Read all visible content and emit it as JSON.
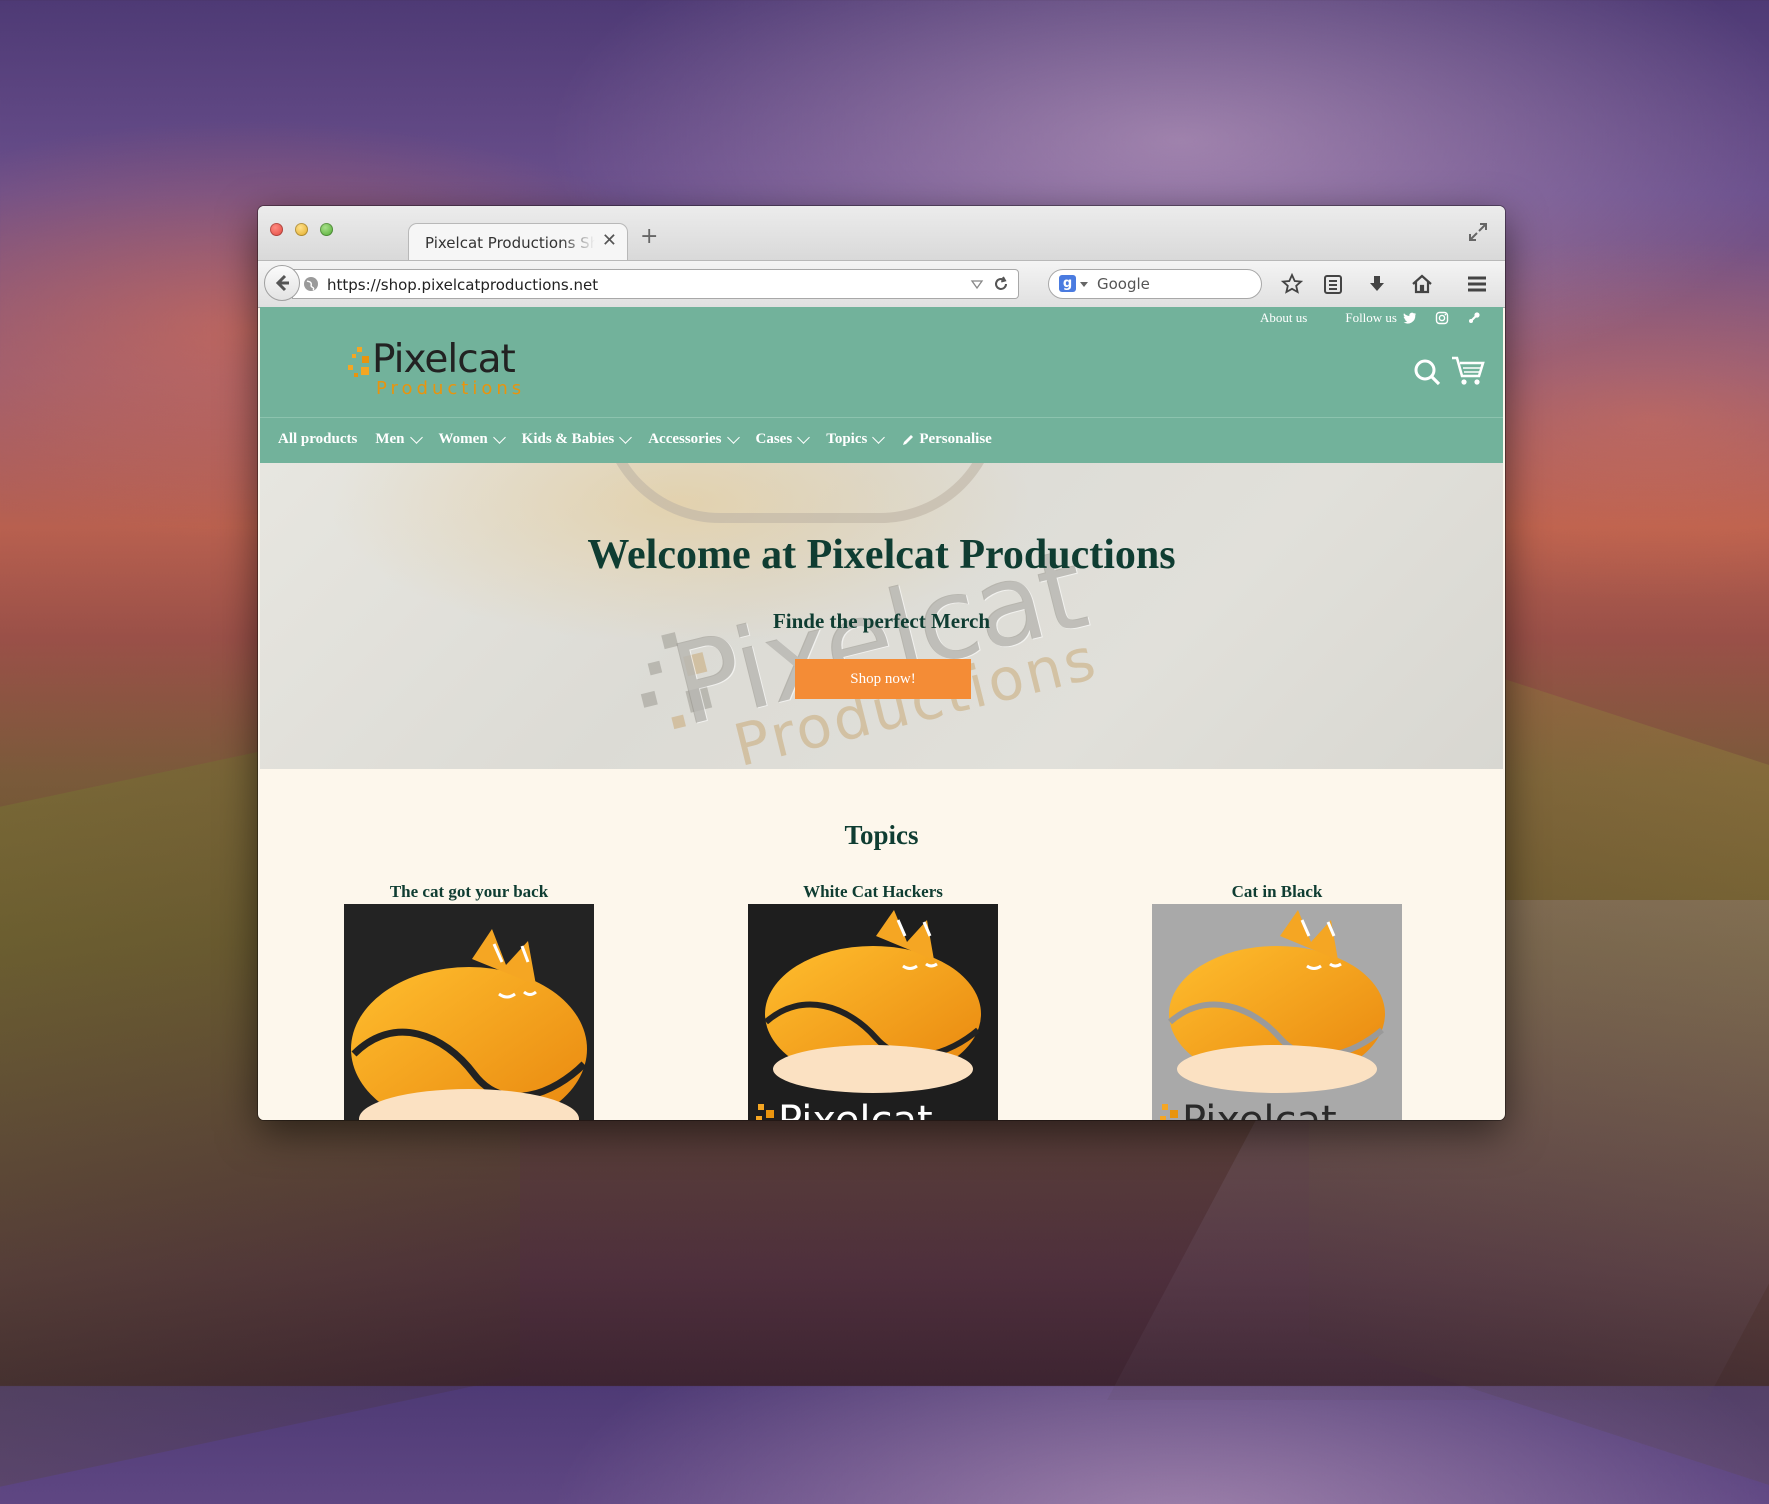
{
  "browser": {
    "tab_title": "Pixelcat Productions Shop",
    "url": "https://shop.pixelcatproductions.net",
    "search_placeholder": "Google",
    "search_engine_badge": "g"
  },
  "site": {
    "colors": {
      "header": "#72b29b",
      "accent": "#f48c36",
      "heading": "#0f3d32",
      "page_bg": "#fdf7ec"
    },
    "toplinks": {
      "about": "About us",
      "follow": "Follow us"
    },
    "logo": {
      "name": "Pixelcat",
      "sub": "Productions"
    },
    "nav": [
      {
        "label": "All products",
        "dropdown": false
      },
      {
        "label": "Men",
        "dropdown": true
      },
      {
        "label": "Women",
        "dropdown": true
      },
      {
        "label": "Kids & Babies",
        "dropdown": true
      },
      {
        "label": "Accessories",
        "dropdown": true
      },
      {
        "label": "Cases",
        "dropdown": true
      },
      {
        "label": "Topics",
        "dropdown": true
      },
      {
        "label": "Personalise",
        "dropdown": false,
        "icon": "pencil-icon"
      }
    ],
    "hero": {
      "title": "Welcome at Pixelcat Productions",
      "subtitle": "Finde the perfect Merch",
      "button": "Shop now!",
      "emboss_name": "Pixelcat",
      "emboss_sub": "Productions"
    },
    "topics": {
      "title": "Topics",
      "cards": [
        {
          "name": "The cat got your back",
          "bg": "#232323",
          "has_logo_text": false
        },
        {
          "name": "White Cat Hackers",
          "bg": "#1e1e1e",
          "has_logo_text": true,
          "logo_text": "Pixelcat"
        },
        {
          "name": "Cat in Black",
          "bg": "#a9a9a9",
          "has_logo_text": true,
          "logo_text": "Pixelcat"
        }
      ]
    }
  }
}
